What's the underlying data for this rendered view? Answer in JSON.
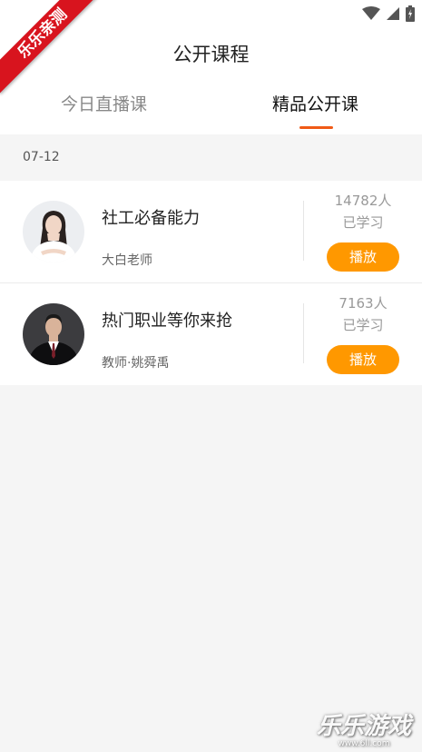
{
  "header": {
    "title": "公开课程",
    "tabs": [
      {
        "label": "今日直播课",
        "active": false
      },
      {
        "label": "精品公开课",
        "active": true
      }
    ],
    "active_color": "#f05a16"
  },
  "date_group": "07-12",
  "courses": [
    {
      "name": "社工必备能力",
      "teacher": "大白老师",
      "learners": "14782人",
      "learners_label": "已学习",
      "play_label": "播放"
    },
    {
      "name": "热门职业等你来抢",
      "teacher": "教师·姚舜禹",
      "learners": "7163人",
      "learners_label": "已学习",
      "play_label": "播放"
    }
  ],
  "overlay": {
    "ribbon_text": "乐乐亲测",
    "watermark_text": "乐乐游戏",
    "watermark_url": "www.6ll.com"
  },
  "icons": [
    "wifi-icon",
    "cellular-signal-icon",
    "battery-charging-icon"
  ]
}
